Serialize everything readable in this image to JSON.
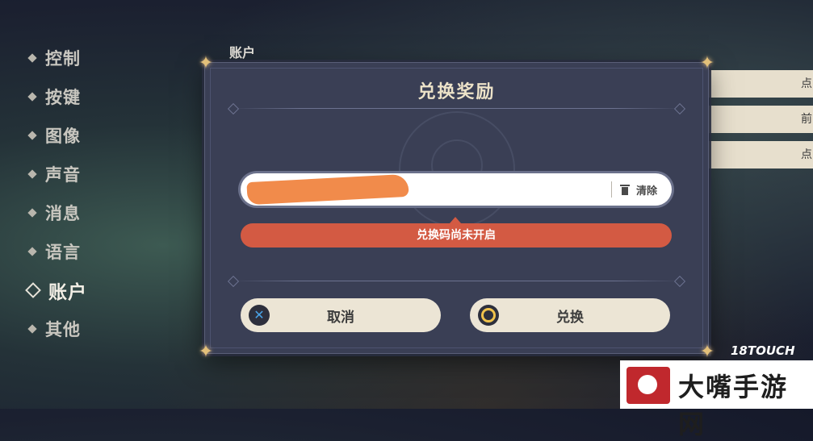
{
  "sidebar": {
    "items": [
      {
        "label": "控制"
      },
      {
        "label": "按键"
      },
      {
        "label": "图像"
      },
      {
        "label": "声音"
      },
      {
        "label": "消息"
      },
      {
        "label": "语言"
      },
      {
        "label": "账户",
        "active": true
      },
      {
        "label": "其他"
      }
    ]
  },
  "section": {
    "title": "账户"
  },
  "right_strips": [
    "点",
    "前",
    "点"
  ],
  "dialog": {
    "title": "兑换奖励",
    "input": {
      "value": "",
      "placeholder": ""
    },
    "clear_label": "清除",
    "error_message": "兑换码尚未开启",
    "cancel_label": "取消",
    "confirm_label": "兑换"
  },
  "watermarks": {
    "touch": "18TOUCH",
    "site": "大嘴手游网"
  },
  "colors": {
    "error": "#d35a43",
    "accent_gold": "#e3c07a",
    "dialog_bg": "#3a3f55"
  },
  "icons": {
    "cancel": "x-button-icon",
    "confirm": "o-button-icon",
    "clear": "trash-icon"
  }
}
